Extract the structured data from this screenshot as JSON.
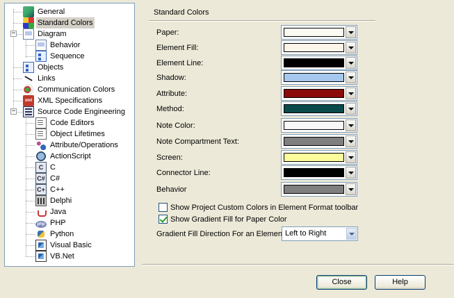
{
  "tree": {
    "items": [
      {
        "label": "General",
        "icon": "general-icon"
      },
      {
        "label": "Standard Colors",
        "icon": "standard-colors-icon",
        "selected": true
      },
      {
        "label": "Diagram",
        "icon": "diagram-icon",
        "expanded": true
      },
      {
        "label": "Behavior",
        "icon": "behavior-icon"
      },
      {
        "label": "Sequence",
        "icon": "sequence-icon"
      },
      {
        "label": "Objects",
        "icon": "objects-icon"
      },
      {
        "label": "Links",
        "icon": "links-icon"
      },
      {
        "label": "Communication Colors",
        "icon": "communication-colors-icon"
      },
      {
        "label": "XML Specifications",
        "icon": "xml-icon"
      },
      {
        "label": "Source Code Engineering",
        "icon": "source-code-icon",
        "expanded": true
      },
      {
        "label": "Code Editors",
        "icon": "code-editors-icon"
      },
      {
        "label": "Object Lifetimes",
        "icon": "object-lifetimes-icon"
      },
      {
        "label": "Attribute/Operations",
        "icon": "attribute-operations-icon"
      },
      {
        "label": "ActionScript",
        "icon": "actionscript-icon"
      },
      {
        "label": "C",
        "icon": "c-icon"
      },
      {
        "label": "C#",
        "icon": "csharp-icon"
      },
      {
        "label": "C++",
        "icon": "cpp-icon"
      },
      {
        "label": "Delphi",
        "icon": "delphi-icon"
      },
      {
        "label": "Java",
        "icon": "java-icon"
      },
      {
        "label": "PHP",
        "icon": "php-icon"
      },
      {
        "label": "Python",
        "icon": "python-icon"
      },
      {
        "label": "Visual Basic",
        "icon": "visual-basic-icon"
      },
      {
        "label": "VB.Net",
        "icon": "vbnet-icon"
      }
    ],
    "expander_minus": "−",
    "xml_glyph": "xml",
    "php_glyph": "php"
  },
  "section": {
    "title": "Standard Colors"
  },
  "colors": [
    {
      "label": "Paper:",
      "color": "#fcfbf2"
    },
    {
      "label": "Element Fill:",
      "color": "#fcf4e8"
    },
    {
      "label": "Element Line:",
      "color": "#000000"
    },
    {
      "label": "Shadow:",
      "color": "#a7c8ee"
    },
    {
      "label": "Attribute:",
      "color": "#8b0a0a"
    },
    {
      "label": "Method:",
      "color": "#0a4a4a"
    },
    {
      "label": "Note Color:",
      "color": "#f8f8f8"
    },
    {
      "label": "Note Compartment Text:",
      "color": "#7f7f7f"
    },
    {
      "label": "Screen:",
      "color": "#fcfc9c"
    },
    {
      "label": "Connector Line:",
      "color": "#000000"
    },
    {
      "label": "Behavior",
      "color": "#7f7f7f"
    }
  ],
  "options": {
    "show_custom_colors": {
      "label": "Show Project Custom Colors in Element Format toolbar",
      "checked": false
    },
    "show_gradient_fill": {
      "label": "Show Gradient Fill for Paper Color",
      "checked": true
    },
    "gradient_direction": {
      "label": "Gradient Fill Direction For an Element:",
      "value": "Left to Right"
    }
  },
  "buttons": {
    "close": "Close",
    "help": "Help"
  }
}
